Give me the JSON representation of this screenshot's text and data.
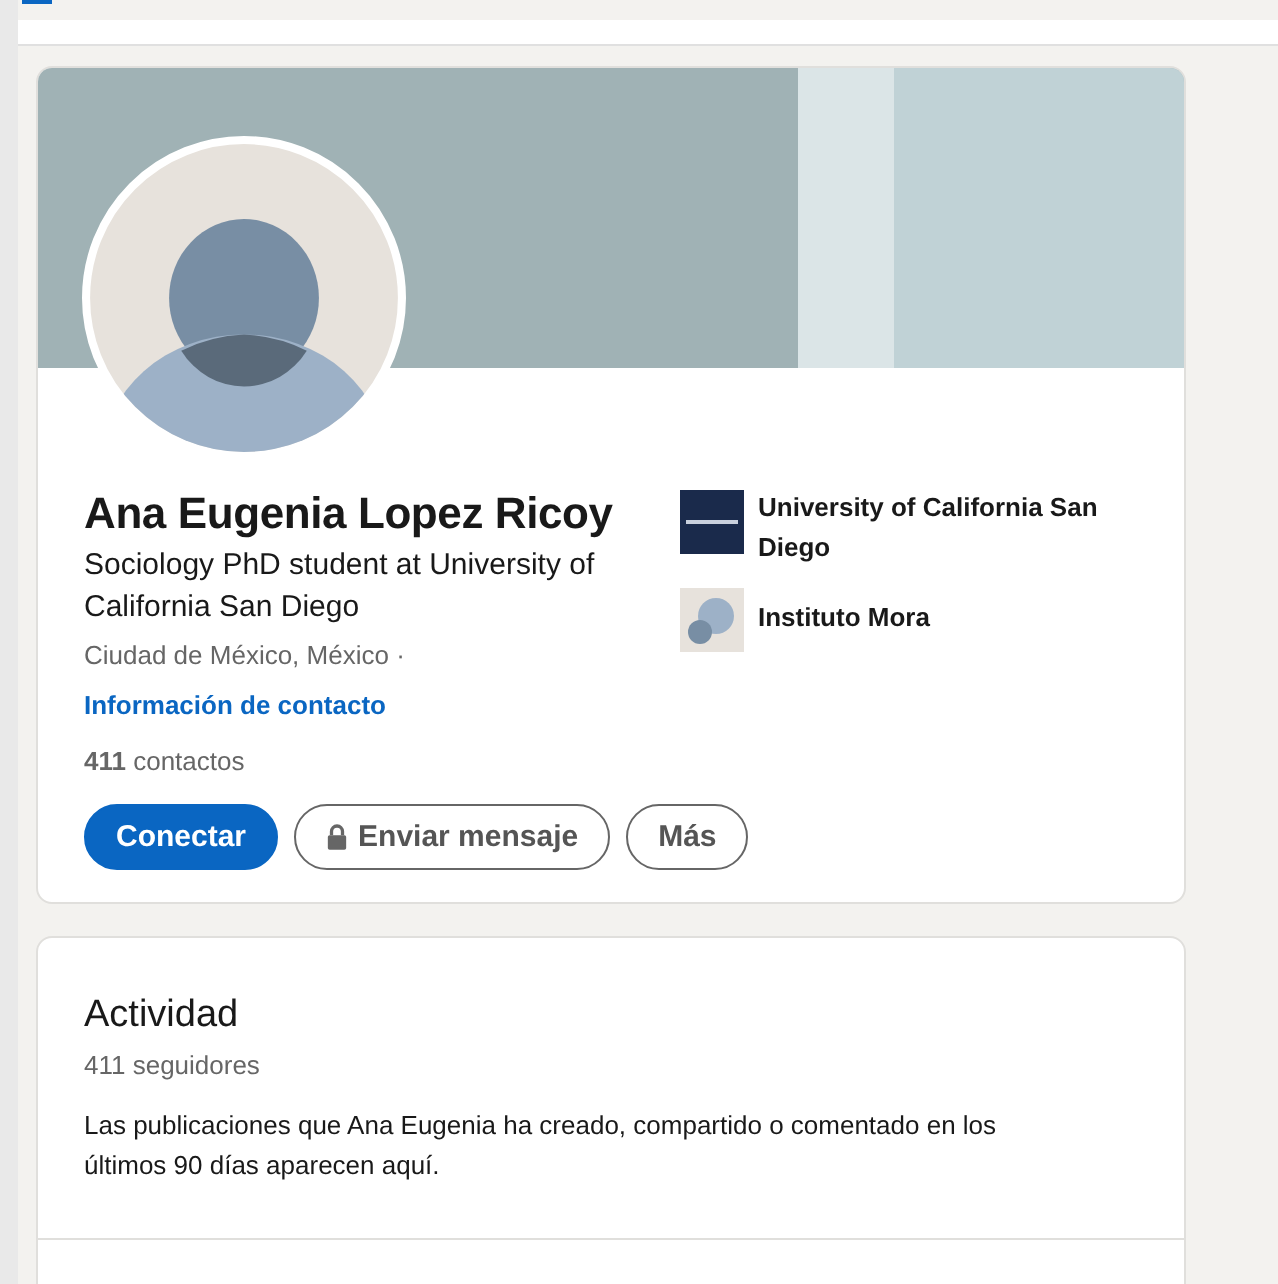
{
  "profile": {
    "name": "Ana Eugenia Lopez Ricoy",
    "headline": "Sociology PhD student at University of California San Diego",
    "location": "Ciudad de México, México ·",
    "contact_link": "Información de contacto",
    "connections": "**411** contactos",
    "organizations": [
      {
        "name": "University of California San Diego",
        "kind": "university"
      },
      {
        "name": "Instituto Mora",
        "kind": "institute"
      }
    ],
    "buttons": [
      {
        "label": "Conectar",
        "kind": "primary"
      },
      {
        "label": "Enviar mensaje",
        "kind": "locked"
      },
      {
        "label": "Más",
        "kind": "secondary"
      }
    ]
  },
  "activity": {
    "title": "Actividad",
    "followers": "411 seguidores",
    "description": "Las publicaciones que Ana Eugenia ha creado, compartido o comentado en los últimos 90 días aparecen aquí."
  }
}
